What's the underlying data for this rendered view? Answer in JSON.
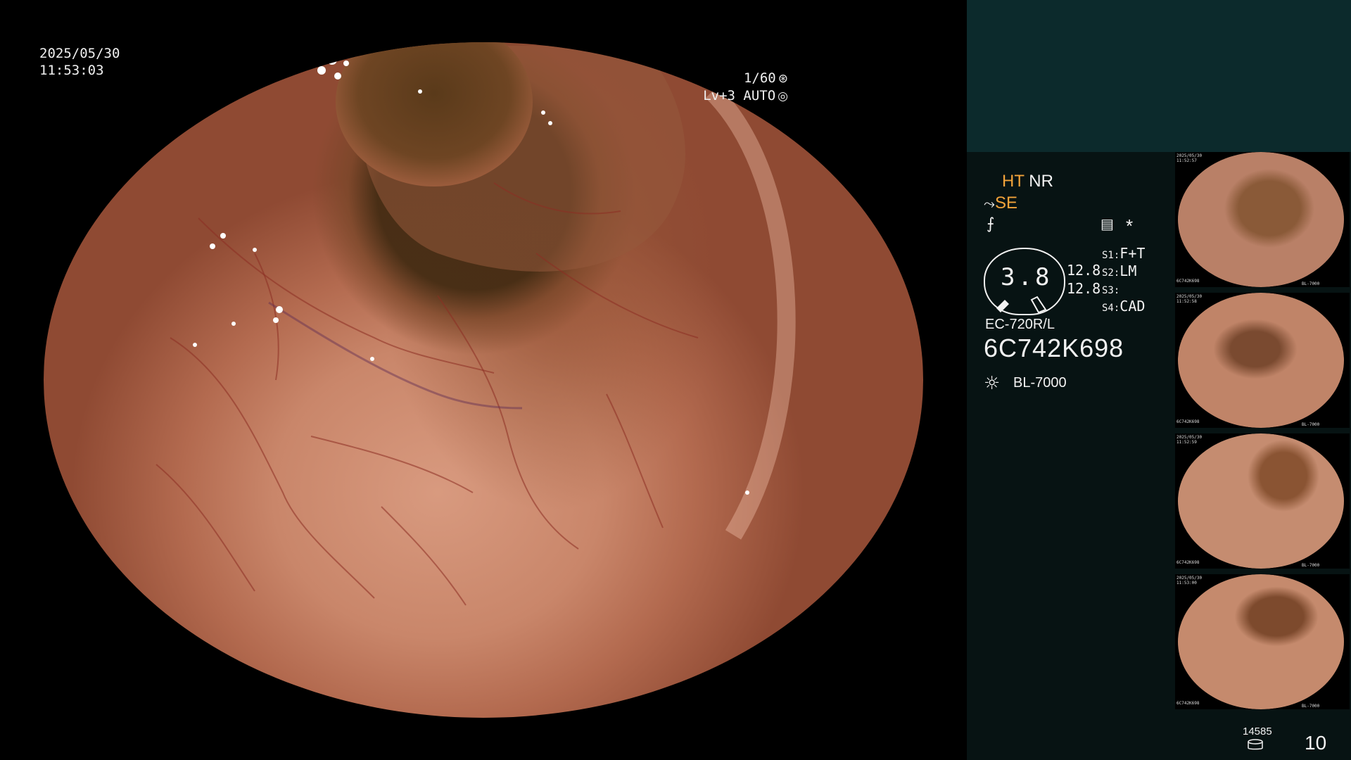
{
  "main_view": {
    "date": "2025/05/30",
    "time": "11:53:03",
    "shutter": "1/60",
    "shutter_icon": "shutter-icon",
    "iris": "Lv+3 AUTO",
    "iris_icon": "iris-icon"
  },
  "side_panel": {
    "mode_ht": "HT",
    "mode_nr": "NR",
    "mode_se": "SE",
    "enhance_icon": "enhance-icon",
    "freeze_icon": "freeze-icon",
    "menu_icon": "menu-icon",
    "star": "*",
    "scope_value": "3.8",
    "readout_top": "12.8",
    "readout_bottom": "12.8",
    "settings": [
      {
        "key": "S1:",
        "value": "F+T"
      },
      {
        "key": "S2:",
        "value": "LM"
      },
      {
        "key": "S3:",
        "value": ""
      },
      {
        "key": "S4:",
        "value": "CAD"
      }
    ],
    "scope_model": "EC-720R/L",
    "scope_serial": "6C742K698",
    "light_source": "BL-7000",
    "light_icon": "light-source-icon"
  },
  "thumbnails": [
    {
      "caption_top": "2025/05/30\n11:52:57",
      "caption_bottom": "6C742K698",
      "label_right": "BL-7000"
    },
    {
      "caption_top": "2025/05/30\n11:52:58",
      "caption_bottom": "6C742K698",
      "label_right": "BL-7000"
    },
    {
      "caption_top": "2025/05/30\n11:52:59",
      "caption_bottom": "6C742K698",
      "label_right": "BL-7000"
    },
    {
      "caption_top": "2025/05/30\n11:53:00",
      "caption_bottom": "6C742K698",
      "label_right": "BL-7000"
    }
  ],
  "footer": {
    "storage_count": "14585",
    "image_count": "10",
    "storage_icon": "storage-icon"
  }
}
